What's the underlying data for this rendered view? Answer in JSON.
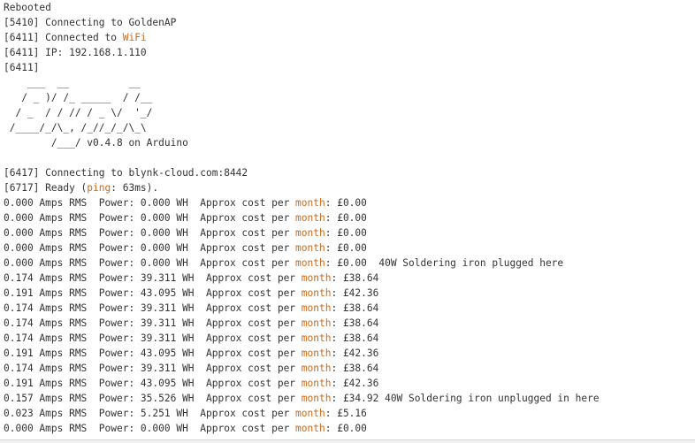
{
  "console": {
    "lines": [
      [
        {
          "t": "Rebooted"
        }
      ],
      [
        {
          "t": "[5410] Connecting to GoldenAP"
        }
      ],
      [
        {
          "t": "[6411] Connected to "
        },
        {
          "t": "WiFi",
          "hl": true
        }
      ],
      [
        {
          "t": "[6411] IP: 192.168.1.110"
        }
      ],
      [
        {
          "t": "[6411]"
        }
      ],
      [
        {
          "t": "    ___  __          __"
        }
      ],
      [
        {
          "t": "   / _ )/ /_ _____  / /__"
        }
      ],
      [
        {
          "t": "  / _  / / // / _ \\/  '_/"
        }
      ],
      [
        {
          "t": " /____/_/\\_, /_//_/_/\\_\\"
        }
      ],
      [
        {
          "t": "        /___/ v0.4.8 on Arduino"
        }
      ],
      [
        {
          "t": ""
        }
      ],
      [
        {
          "t": "[6417] Connecting to blynk-cloud.com:8442"
        }
      ],
      [
        {
          "t": "[6717] Ready ("
        },
        {
          "t": "ping",
          "hl": true
        },
        {
          "t": ": 63ms)."
        }
      ],
      [
        {
          "t": "0.000 Amps RMS  Power: 0.000 WH  Approx cost per "
        },
        {
          "t": "month",
          "hl": true
        },
        {
          "t": ": £0.00"
        }
      ],
      [
        {
          "t": "0.000 Amps RMS  Power: 0.000 WH  Approx cost per "
        },
        {
          "t": "month",
          "hl": true
        },
        {
          "t": ": £0.00"
        }
      ],
      [
        {
          "t": "0.000 Amps RMS  Power: 0.000 WH  Approx cost per "
        },
        {
          "t": "month",
          "hl": true
        },
        {
          "t": ": £0.00"
        }
      ],
      [
        {
          "t": "0.000 Amps RMS  Power: 0.000 WH  Approx cost per "
        },
        {
          "t": "month",
          "hl": true
        },
        {
          "t": ": £0.00"
        }
      ],
      [
        {
          "t": "0.000 Amps RMS  Power: 0.000 WH  Approx cost per "
        },
        {
          "t": "month",
          "hl": true
        },
        {
          "t": ": £0.00  40W Soldering iron plugged here"
        }
      ],
      [
        {
          "t": "0.174 Amps RMS  Power: 39.311 WH  Approx cost per "
        },
        {
          "t": "month",
          "hl": true
        },
        {
          "t": ": £38.64"
        }
      ],
      [
        {
          "t": "0.191 Amps RMS  Power: 43.095 WH  Approx cost per "
        },
        {
          "t": "month",
          "hl": true
        },
        {
          "t": ": £42.36"
        }
      ],
      [
        {
          "t": "0.174 Amps RMS  Power: 39.311 WH  Approx cost per "
        },
        {
          "t": "month",
          "hl": true
        },
        {
          "t": ": £38.64"
        }
      ],
      [
        {
          "t": "0.174 Amps RMS  Power: 39.311 WH  Approx cost per "
        },
        {
          "t": "month",
          "hl": true
        },
        {
          "t": ": £38.64"
        }
      ],
      [
        {
          "t": "0.174 Amps RMS  Power: 39.311 WH  Approx cost per "
        },
        {
          "t": "month",
          "hl": true
        },
        {
          "t": ": £38.64"
        }
      ],
      [
        {
          "t": "0.191 Amps RMS  Power: 43.095 WH  Approx cost per "
        },
        {
          "t": "month",
          "hl": true
        },
        {
          "t": ": £42.36"
        }
      ],
      [
        {
          "t": "0.174 Amps RMS  Power: 39.311 WH  Approx cost per "
        },
        {
          "t": "month",
          "hl": true
        },
        {
          "t": ": £38.64"
        }
      ],
      [
        {
          "t": "0.191 Amps RMS  Power: 43.095 WH  Approx cost per "
        },
        {
          "t": "month",
          "hl": true
        },
        {
          "t": ": £42.36"
        }
      ],
      [
        {
          "t": "0.157 Amps RMS  Power: 35.526 WH  Approx cost per "
        },
        {
          "t": "month",
          "hl": true
        },
        {
          "t": ": £34.92 40W Soldering iron unplugged in here"
        }
      ],
      [
        {
          "t": "0.023 Amps RMS  Power: 5.251 WH  Approx cost per "
        },
        {
          "t": "month",
          "hl": true
        },
        {
          "t": ": £5.16"
        }
      ],
      [
        {
          "t": "0.000 Amps RMS  Power: 0.000 WH  Approx cost per "
        },
        {
          "t": "month",
          "hl": true
        },
        {
          "t": ": £0.00"
        }
      ]
    ]
  },
  "colors": {
    "text": "#333333",
    "keyword": "#cc6a1a",
    "background": "#ffffff"
  }
}
